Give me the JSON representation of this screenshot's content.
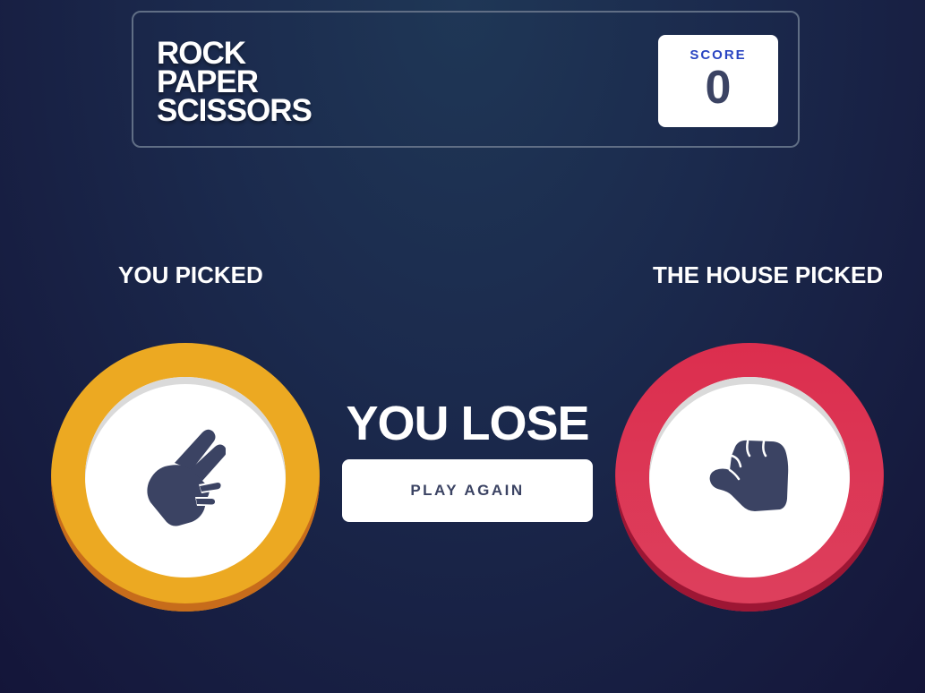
{
  "header": {
    "title_lines": [
      "ROCK",
      "PAPER",
      "SCISSORS"
    ],
    "score_label": "SCORE",
    "score_value": "0"
  },
  "player": {
    "label": "YOU PICKED",
    "choice": "scissors",
    "icon": "scissors-hand-icon",
    "color": "#eca922"
  },
  "house": {
    "label": "THE HOUSE PICKED",
    "choice": "rock",
    "icon": "rock-fist-icon",
    "color": "#dc2e4e"
  },
  "result": {
    "text": "YOU LOSE",
    "button_label": "PLAY AGAIN"
  },
  "colors": {
    "background": "#1f3756",
    "text_dark": "#3b4363",
    "score_text": "#2a45c2",
    "header_outline": "#606e85"
  }
}
